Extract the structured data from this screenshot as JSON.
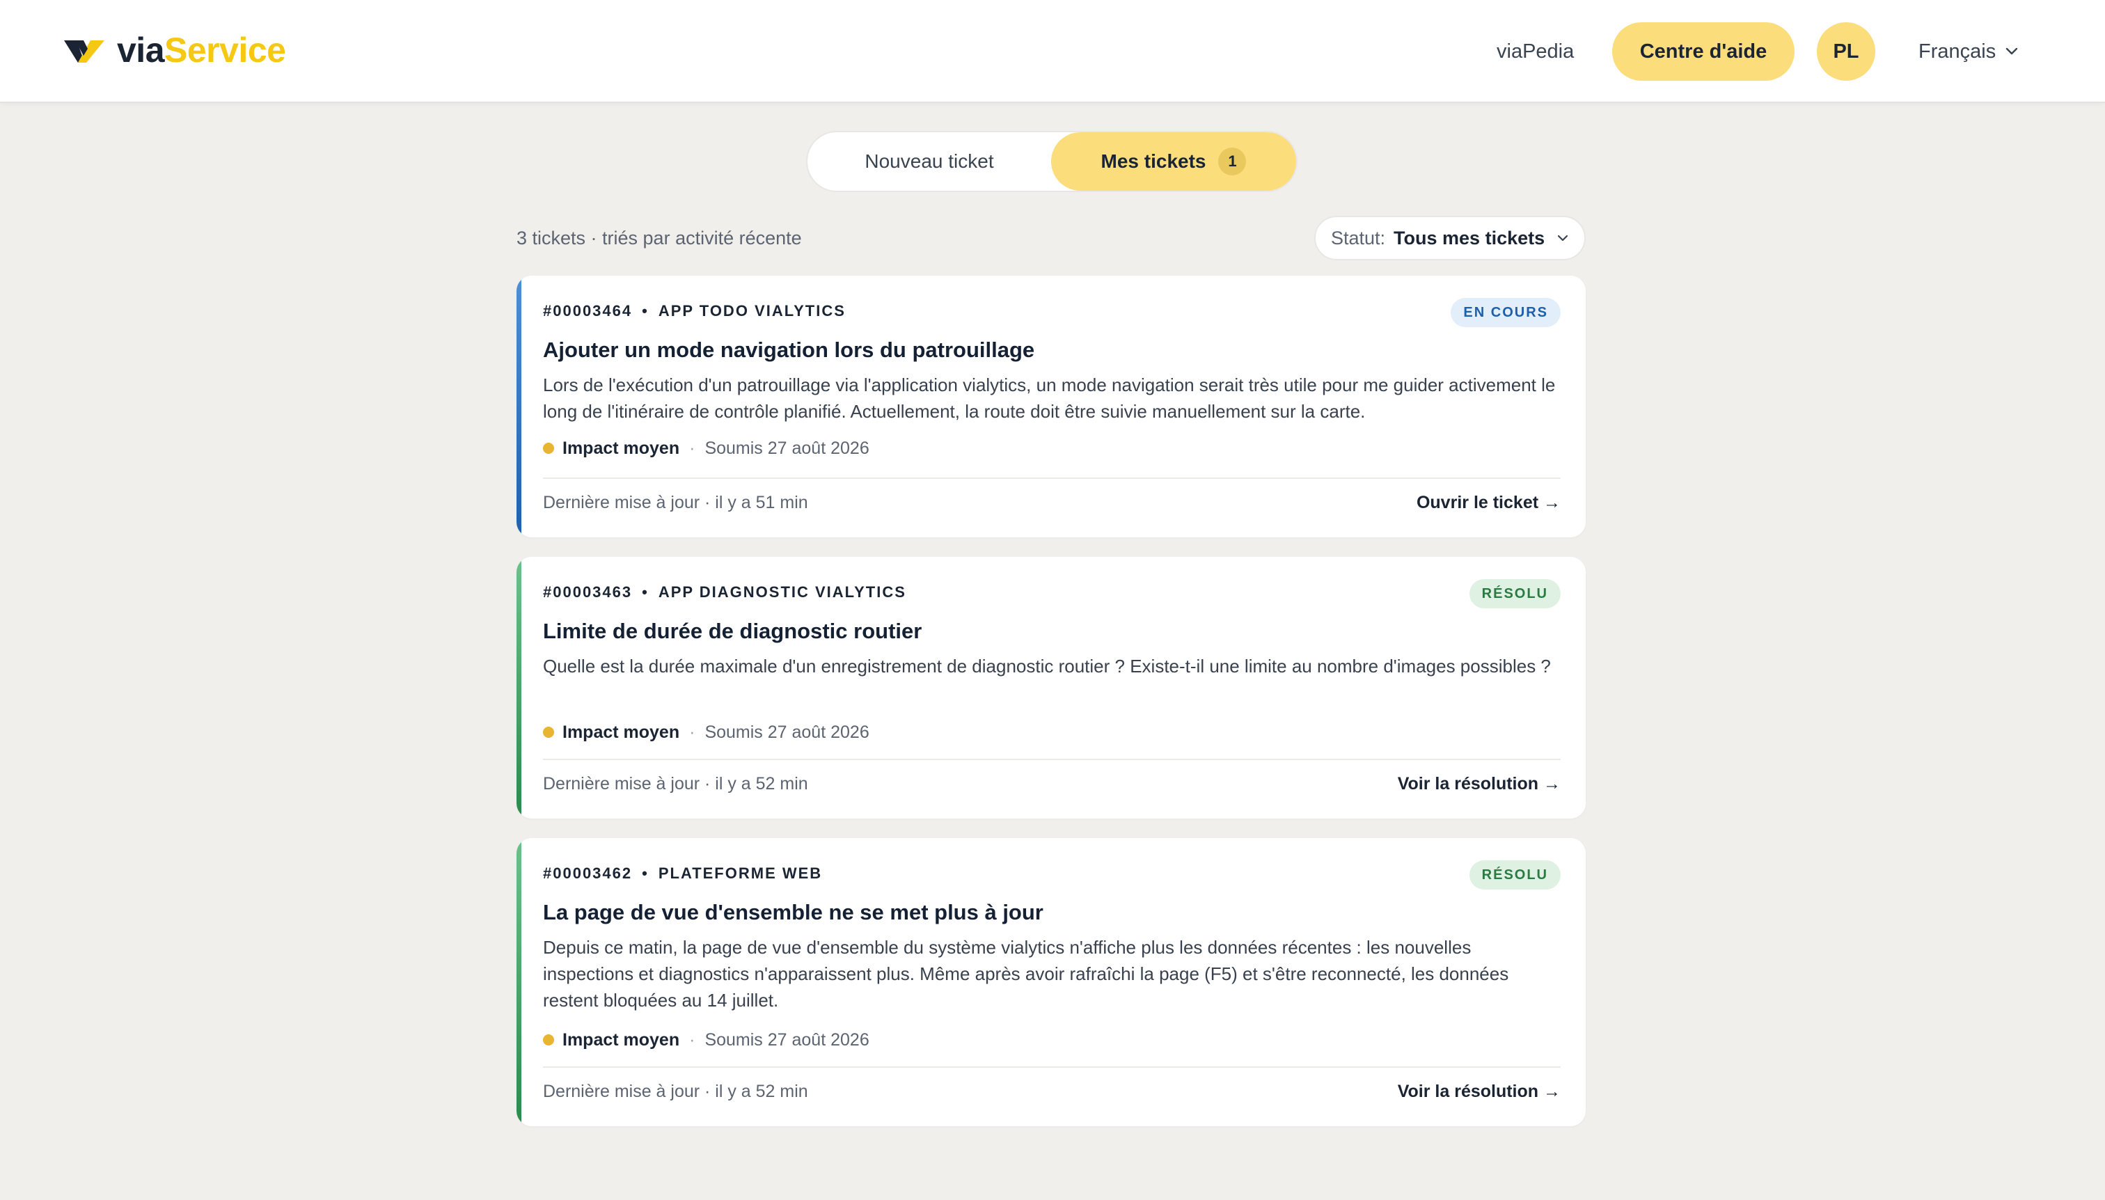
{
  "header": {
    "logo": {
      "part1": "via",
      "part2": "Service"
    },
    "nav_link": "viaPedia",
    "help_button": "Centre d'aide",
    "avatar_initials": "PL",
    "language": "Français"
  },
  "tabs": {
    "new_ticket": "Nouveau ticket",
    "my_tickets": "Mes tickets",
    "my_tickets_count": "1"
  },
  "list": {
    "summary": "3 tickets · triés par activité récente",
    "filter_label": "Statut:",
    "filter_value": "Tous mes tickets"
  },
  "colors": {
    "accent_yellow": "#fbdd7c",
    "brand_yellow": "#f5c814",
    "in_progress": "#2f6fbf",
    "resolved": "#2f8a4c",
    "impact_medium": "#e8b431"
  },
  "tickets": [
    {
      "id": "#00003464",
      "category": "APP TODO VIALYTICS",
      "status": "EN COURS",
      "title": "Ajouter un mode navigation lors du patrouillage",
      "description": "Lors de l'exécution d'un patrouillage via l'application vialytics, un mode navigation serait très utile pour me guider activement le long de l'itinéraire de contrôle planifié. Actuellement, la route doit être suivie manuellement sur la carte.",
      "impact": "Impact moyen",
      "submitted": "Soumis 27 août 2026",
      "updated": "Dernière mise à jour · il y a 51 min",
      "action": "Ouvrir le ticket →"
    },
    {
      "id": "#00003463",
      "category": "APP DIAGNOSTIC VIALYTICS",
      "status": "RÉSOLU",
      "title": "Limite de durée de diagnostic routier",
      "description": "Quelle est la durée maximale d'un enregistrement de diagnostic routier ? Existe-t-il une limite au nombre d'images possibles ?",
      "impact": "Impact moyen",
      "submitted": "Soumis 27 août 2026",
      "updated": "Dernière mise à jour · il y a 52 min",
      "action": "Voir la résolution →"
    },
    {
      "id": "#00003462",
      "category": "PLATEFORME WEB",
      "status": "RÉSOLU",
      "title": "La page de vue d'ensemble ne se met plus à jour",
      "description": "Depuis ce matin, la page de vue d'ensemble du système vialytics n'affiche plus les données récentes : les nouvelles inspections et diagnostics n'apparaissent plus. Même après avoir rafraîchi la page (F5) et s'être reconnecté, les données restent bloquées au 14 juillet.",
      "impact": "Impact moyen",
      "submitted": "Soumis 27 août 2026",
      "updated": "Dernière mise à jour · il y a 52 min",
      "action": "Voir la résolution →"
    }
  ]
}
